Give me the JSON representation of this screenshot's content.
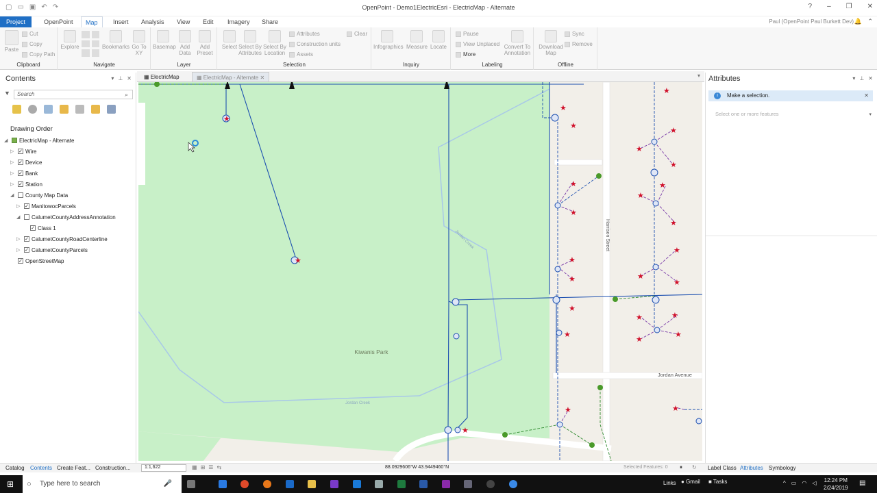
{
  "window": {
    "title": "OpenPoint - Demo1ElectricEsri - ElectricMap - Alternate",
    "controls": [
      "?",
      "–",
      "❐",
      "✕"
    ]
  },
  "ribbon": {
    "tabs": [
      "Project",
      "OpenPoint",
      "Map",
      "Insert",
      "Analysis",
      "View",
      "Edit",
      "Imagery",
      "Share"
    ],
    "active_tab": "Map",
    "user": "Paul (OpenPoint Paul Burkett Dev)",
    "groups": {
      "clipboard": {
        "label": "Clipboard",
        "paste": "Paste",
        "cut": "Cut",
        "copy": "Copy",
        "copy_path": "Copy Path"
      },
      "navigate": {
        "label": "Navigate",
        "explore": "Explore",
        "bookmarks": "Bookmarks",
        "goto": "Go To XY"
      },
      "layer": {
        "label": "Layer",
        "basemap": "Basemap",
        "add_data": "Add Data",
        "add_preset": "Add Preset"
      },
      "selection": {
        "label": "Selection",
        "select": "Select",
        "by_attributes": "Select By Attributes",
        "by_location": "Select By Location",
        "attributes": "Attributes",
        "construction_units": "Construction units",
        "assets": "Assets",
        "clear": "Clear"
      },
      "inquiry": {
        "label": "Inquiry",
        "infographics": "Infographics",
        "measure": "Measure",
        "locate": "Locate"
      },
      "labeling": {
        "label": "Labeling",
        "pause": "Pause",
        "view_unplaced": "View Unplaced",
        "more": "More",
        "convert": "Convert To Annotation"
      },
      "offline": {
        "label": "Offline",
        "download": "Download Map",
        "sync": "Sync",
        "remove": "Remove"
      }
    }
  },
  "contents": {
    "title": "Contents",
    "search_placeholder": "Search",
    "drawing_order": "Drawing Order",
    "layers": [
      {
        "name": "ElectricMap - Alternate",
        "level": 0,
        "twisty": "◢",
        "checked": "map"
      },
      {
        "name": "Wire",
        "level": 1,
        "twisty": "▷",
        "checked": true
      },
      {
        "name": "Device",
        "level": 1,
        "twisty": "▷",
        "checked": true
      },
      {
        "name": "Bank",
        "level": 1,
        "twisty": "▷",
        "checked": true
      },
      {
        "name": "Station",
        "level": 1,
        "twisty": "▷",
        "checked": true
      },
      {
        "name": "County Map Data",
        "level": 1,
        "twisty": "◢",
        "checked": false
      },
      {
        "name": "ManitowocParcels",
        "level": 2,
        "twisty": "▷",
        "checked": true
      },
      {
        "name": "CalumetCountyAddressAnnotation",
        "level": 2,
        "twisty": "◢",
        "checked": false
      },
      {
        "name": "Class 1",
        "level": 3,
        "twisty": "",
        "checked": true
      },
      {
        "name": "CalumetCountyRoadCenterline",
        "level": 2,
        "twisty": "▷",
        "checked": true
      },
      {
        "name": "CalumetCountyParcels",
        "level": 2,
        "twisty": "▷",
        "checked": true
      },
      {
        "name": "OpenStreetMap",
        "level": 1,
        "twisty": "",
        "checked": true
      }
    ]
  },
  "map_tabs": [
    "ElectricMap",
    "ElectricMap - Alternate"
  ],
  "map": {
    "labels": {
      "park": "Kiwanis Park",
      "street1": "Harrison Street",
      "street2": "Jordan Avenue",
      "creek1": "Jordan Creek",
      "creek2": "Jordan Creek"
    }
  },
  "attributes": {
    "title": "Attributes",
    "banner": "Make a selection.",
    "select_prompt": "Select one or more features"
  },
  "statusbar": {
    "tabs_left": [
      "Catalog",
      "Contents",
      "Create Feat...",
      "Construction..."
    ],
    "active_left": "Contents",
    "scale": "1:1,622",
    "coords": "88.0929606°W 43.9449460°N",
    "selected_features": "Selected Features: 0",
    "tabs_right": [
      "Label Class",
      "Attributes",
      "Symbology"
    ],
    "active_right": "Attributes"
  },
  "taskbar": {
    "search_placeholder": "Type here to search",
    "links": "Links",
    "gmail": "Gmail",
    "tasks": "Tasks",
    "time": "12:24 PM",
    "date": "2/24/2019"
  },
  "colors": {
    "accent": "#1f6fc5",
    "park": "#c8f0c8",
    "wire": "#1c4fb0",
    "device": "#d0102a",
    "secondary": "#6a2f9a"
  }
}
